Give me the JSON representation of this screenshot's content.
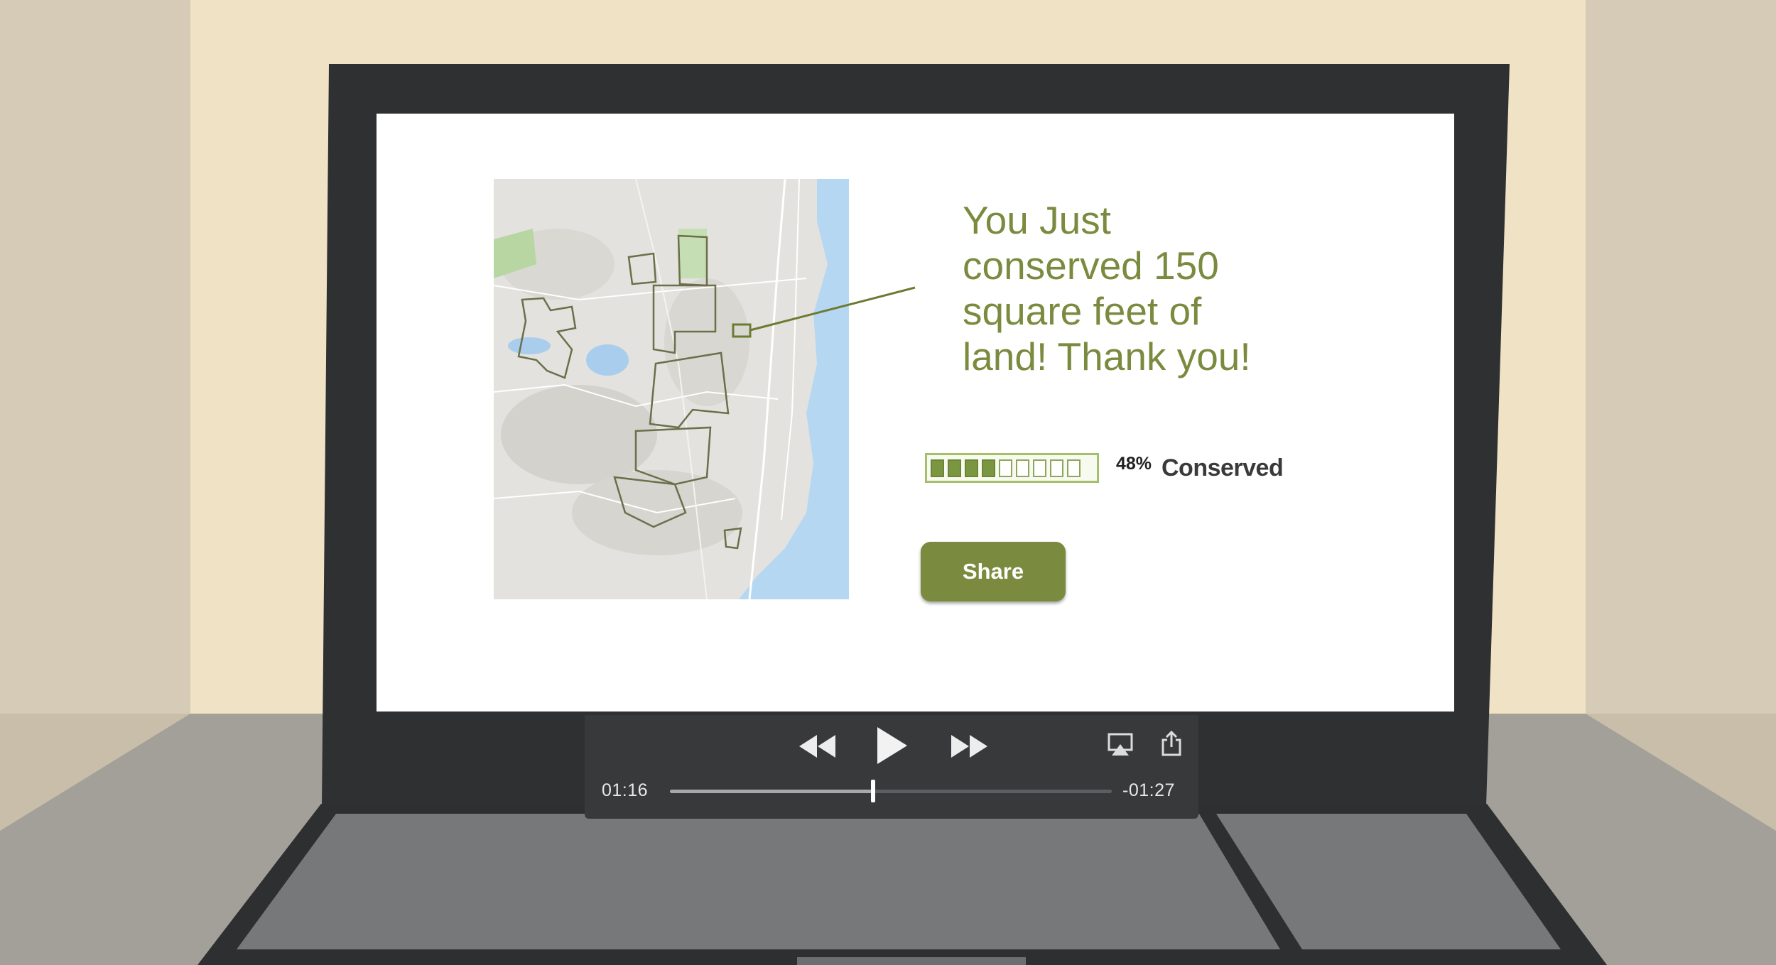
{
  "slide": {
    "headline_lines": [
      "You Just",
      "conserved 150",
      "square feet of",
      "land! Thank you!"
    ],
    "progress": {
      "percent_label": "48%",
      "label": "Conserved",
      "segments_total": 9,
      "segments_filled": 4,
      "fill_color": "#7b9640"
    },
    "share_label": "Share",
    "accent_color": "#7a8a3e"
  },
  "player": {
    "elapsed": "01:16",
    "remaining": "-01:27",
    "progress_fraction": 0.46,
    "buttons": {
      "rewind": "rewind-icon",
      "play": "play-icon",
      "fast_forward": "fast-forward-icon",
      "airplay": "airplay-icon",
      "share": "share-icon"
    }
  }
}
